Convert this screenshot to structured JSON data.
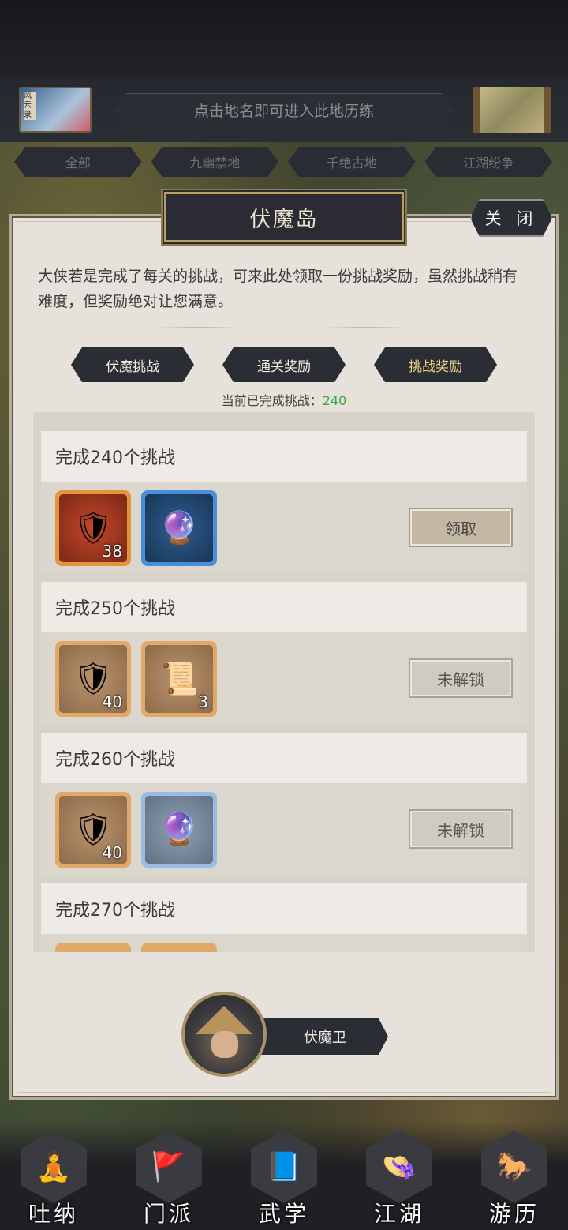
{
  "map_header": {
    "scroll_label": "风云录",
    "hint": "点击地名即可进入此地历练",
    "tabs": [
      "全部",
      "九幽禁地",
      "千绝古地",
      "江湖纷争"
    ]
  },
  "dialog": {
    "title": "伏魔岛",
    "close_label": "关 闭",
    "description": "大侠若是完成了每关的挑战，可来此处领取一份挑战奖励，虽然挑战稍有难度，但奖励绝对让您满意。",
    "tabs": [
      {
        "label": "伏魔挑战",
        "active": false
      },
      {
        "label": "通关奖励",
        "active": false
      },
      {
        "label": "挑战奖励",
        "active": true
      }
    ],
    "progress_label": "当前已完成挑战：",
    "progress_value": "240",
    "rewards": [
      {
        "title": "完成240个挑战",
        "button": "领取",
        "items": [
          {
            "icon": "shield-badge-icon",
            "glyph": "🛡",
            "count": "38"
          },
          {
            "icon": "orb-pedestal-icon",
            "glyph": "🔮",
            "count": ""
          }
        ]
      },
      {
        "title": "完成250个挑战",
        "button": "未解锁",
        "items": [
          {
            "icon": "shield-badge-icon",
            "glyph": "🛡",
            "count": "40"
          },
          {
            "icon": "scroll-icon",
            "glyph": "📜",
            "count": "3"
          }
        ]
      },
      {
        "title": "完成260个挑战",
        "button": "未解锁",
        "items": [
          {
            "icon": "shield-badge-icon",
            "glyph": "🛡",
            "count": "40"
          },
          {
            "icon": "orb-pedestal-icon",
            "glyph": "🔮",
            "count": ""
          }
        ]
      },
      {
        "title": "完成270个挑战",
        "button": "",
        "items": []
      }
    ],
    "npc_name": "伏魔卫"
  },
  "bottom_nav": [
    {
      "label": "吐纳",
      "icon": "meditation-icon",
      "glyph": "🧘"
    },
    {
      "label": "门派",
      "icon": "sect-flag-icon",
      "glyph": "🚩"
    },
    {
      "label": "武学",
      "icon": "book-icon",
      "glyph": "📘"
    },
    {
      "label": "江湖",
      "icon": "straw-hat-icon",
      "glyph": "👒"
    },
    {
      "label": "游历",
      "icon": "horse-icon",
      "glyph": "🐎"
    }
  ],
  "colors": {
    "progress_value": "#3aa843",
    "active_tab_text": "#ead186",
    "panel_bg": "#e6e2db",
    "dark_plate": "#2b2d34"
  }
}
